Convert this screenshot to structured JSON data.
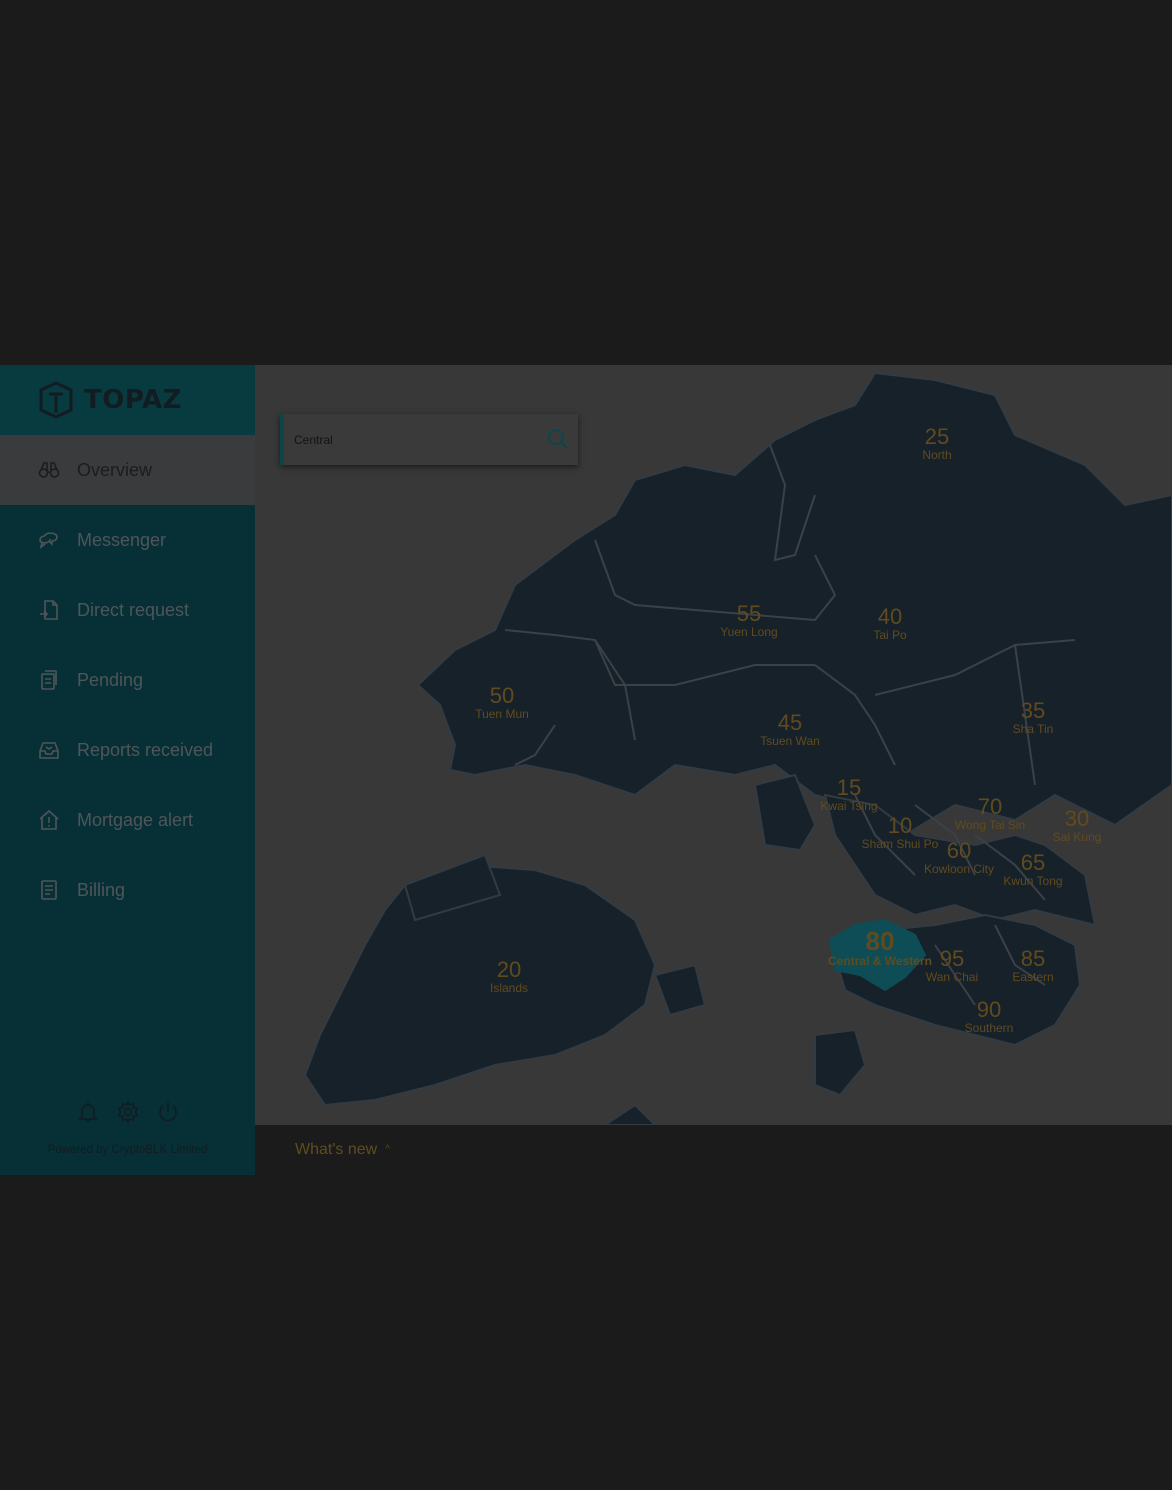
{
  "brand": {
    "name": "TOPAZ"
  },
  "sidebar": {
    "items": [
      {
        "label": "Overview",
        "icon": "binoculars-icon",
        "active": true
      },
      {
        "label": "Messenger",
        "icon": "chat-icon",
        "active": false
      },
      {
        "label": "Direct request",
        "icon": "document-request-icon",
        "active": false
      },
      {
        "label": "Pending",
        "icon": "pending-icon",
        "active": false
      },
      {
        "label": "Reports received",
        "icon": "inbox-icon",
        "active": false
      },
      {
        "label": "Mortgage alert",
        "icon": "house-alert-icon",
        "active": false
      },
      {
        "label": "Billing",
        "icon": "billing-icon",
        "active": false
      }
    ],
    "footer_icons": [
      "bell-icon",
      "gear-icon",
      "power-icon"
    ],
    "powered_by": "Powered by CryptoBLK Limited"
  },
  "search": {
    "value": "Central"
  },
  "map": {
    "districts": [
      {
        "value": "25",
        "name": "North"
      },
      {
        "value": "55",
        "name": "Yuen Long"
      },
      {
        "value": "40",
        "name": "Tai Po"
      },
      {
        "value": "50",
        "name": "Tuen Mun"
      },
      {
        "value": "45",
        "name": "Tsuen Wan"
      },
      {
        "value": "35",
        "name": "Sha Tin"
      },
      {
        "value": "15",
        "name": "Kwai Tsing"
      },
      {
        "value": "70",
        "name": "Wong Tai Sin"
      },
      {
        "value": "30",
        "name": "Sai Kung"
      },
      {
        "value": "10",
        "name": "Sham Shui Po"
      },
      {
        "value": "60",
        "name": "Kowloon City"
      },
      {
        "value": "65",
        "name": "Kwun Tong"
      },
      {
        "value": "80",
        "name": "Central & Western",
        "highlighted": true
      },
      {
        "value": "95",
        "name": "Wan Chai"
      },
      {
        "value": "85",
        "name": "Eastern"
      },
      {
        "value": "90",
        "name": "Southern"
      },
      {
        "value": "20",
        "name": "Islands"
      }
    ],
    "colors": {
      "land": "#17212a",
      "sea": "#383838",
      "highlight": "#0e4d55",
      "label": "#614b1e"
    }
  },
  "bottom_bar": {
    "whats_new": "What's new"
  }
}
